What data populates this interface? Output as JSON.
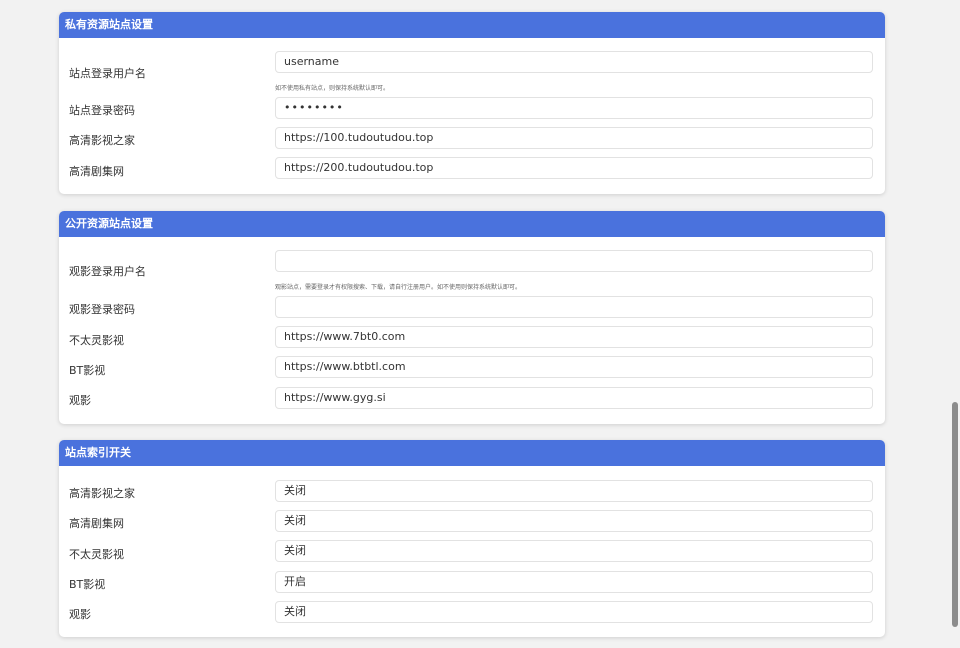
{
  "private_sites": {
    "title": "私有资源站点设置",
    "username_label": "站点登录用户名",
    "username_value": "username",
    "hint": "如不使用私有站点，则保持系统默认即可。",
    "password_label": "站点登录密码",
    "password_value": "••••••••",
    "site1_label": "高清影视之家",
    "site1_value": "https://100.tudoutudou.top",
    "site2_label": "高清剧集网",
    "site2_value": "https://200.tudoutudou.top"
  },
  "public_sites": {
    "title": "公开资源站点设置",
    "username_label": "观影登录用户名",
    "username_value": "",
    "hint": "观影站点，需要登录才有权限搜索、下载，请自行注册用户。如不使用则保持系统默认即可。",
    "password_label": "观影登录密码",
    "password_value": "",
    "site1_label": "不太灵影视",
    "site1_value": "https://www.7bt0.com",
    "site2_label": "BT影视",
    "site2_value": "https://www.btbtl.com",
    "site3_label": "观影",
    "site3_value": "https://www.gyg.si"
  },
  "index_switch": {
    "title": "站点索引开关",
    "items": [
      {
        "label": "高清影视之家",
        "value": "关闭"
      },
      {
        "label": "高清剧集网",
        "value": "关闭"
      },
      {
        "label": "不太灵影视",
        "value": "关闭"
      },
      {
        "label": "BT影视",
        "value": "开启"
      },
      {
        "label": "观影",
        "value": "关闭"
      }
    ]
  }
}
